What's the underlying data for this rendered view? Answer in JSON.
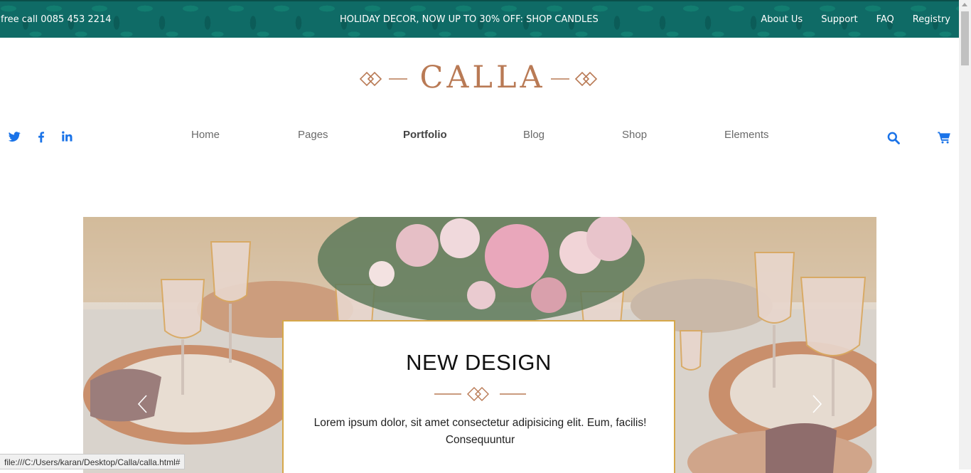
{
  "topbar": {
    "phone": "free call 0085 453 2214",
    "promo": "HOLIDAY DECOR, NOW UP TO 30% OFF: SHOP CANDLES",
    "links": [
      "About Us",
      "Support",
      "FAQ",
      "Registry"
    ]
  },
  "logo": {
    "text": "CALLA"
  },
  "social": [
    "twitter-icon",
    "facebook-icon",
    "linkedin-icon"
  ],
  "nav": {
    "items": [
      {
        "label": "Home",
        "active": false
      },
      {
        "label": "Pages",
        "active": false
      },
      {
        "label": "Portfolio",
        "active": true
      },
      {
        "label": "Blog",
        "active": false
      },
      {
        "label": "Shop",
        "active": false
      },
      {
        "label": "Elements",
        "active": false
      }
    ]
  },
  "tools": [
    "search-icon",
    "cart-icon"
  ],
  "hero": {
    "title": "NEW DESIGN",
    "body": "Lorem ipsum dolor, sit amet consectetur adipisicing elit. Eum, facilis! Consequuntur",
    "prev_icon": "chevron-left-icon",
    "next_icon": "chevron-right-icon"
  },
  "statusbar": {
    "url": "file:///C:/Users/karan/Desktop/Calla/calla.html#"
  },
  "colors": {
    "topbar_bg": "#0f6b66",
    "brand": "#b97a55",
    "accent_blue": "#1a73e8",
    "card_border": "#d6a84a"
  }
}
